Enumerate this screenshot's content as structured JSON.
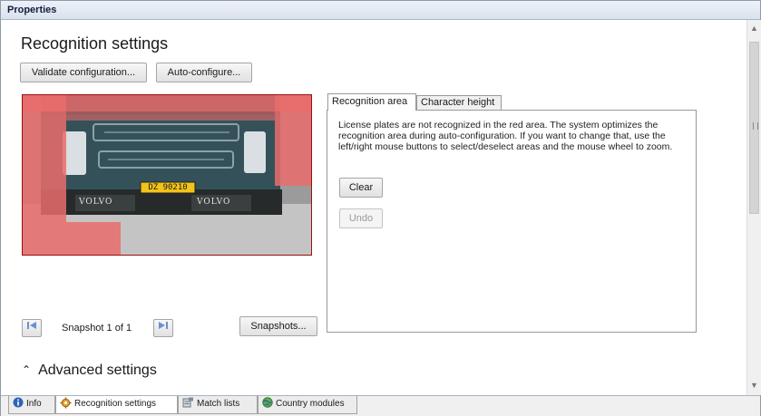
{
  "window": {
    "title": "Properties"
  },
  "main": {
    "heading": "Recognition settings",
    "validate_label": "Validate configuration...",
    "autoconfigure_label": "Auto-configure...",
    "plate_text": "DZ 90210",
    "badge_text": "VOLVO"
  },
  "tabs": [
    {
      "label": "Recognition area",
      "selected": true
    },
    {
      "label": "Character height",
      "selected": false
    }
  ],
  "panel": {
    "description": "License plates are not recognized in the red area. The system optimizes the recognition area during auto-configuration. If you want to change that, use the left/right mouse buttons to select/deselect areas and the mouse wheel to zoom.",
    "clear_label": "Clear",
    "undo_label": "Undo"
  },
  "snapshot_nav": {
    "prev_icon": "prev-arrow-icon",
    "label": "Snapshot 1 of 1",
    "next_icon": "next-arrow-icon",
    "snapshots_label": "Snapshots..."
  },
  "advanced": {
    "label": "Advanced settings",
    "icon": "chevron-up-icon"
  },
  "bottom_tabs": [
    {
      "label": "Info",
      "icon": "info-icon",
      "active": false
    },
    {
      "label": "Recognition settings",
      "icon": "gear-icon",
      "active": true
    },
    {
      "label": "Match lists",
      "icon": "match-lists-icon",
      "active": false
    },
    {
      "label": "Country modules",
      "icon": "globe-icon",
      "active": false
    }
  ],
  "colors": {
    "mask_red": "#ea6c6c",
    "truck_body": "#34515a",
    "accent_blue": "#2f62b8"
  }
}
